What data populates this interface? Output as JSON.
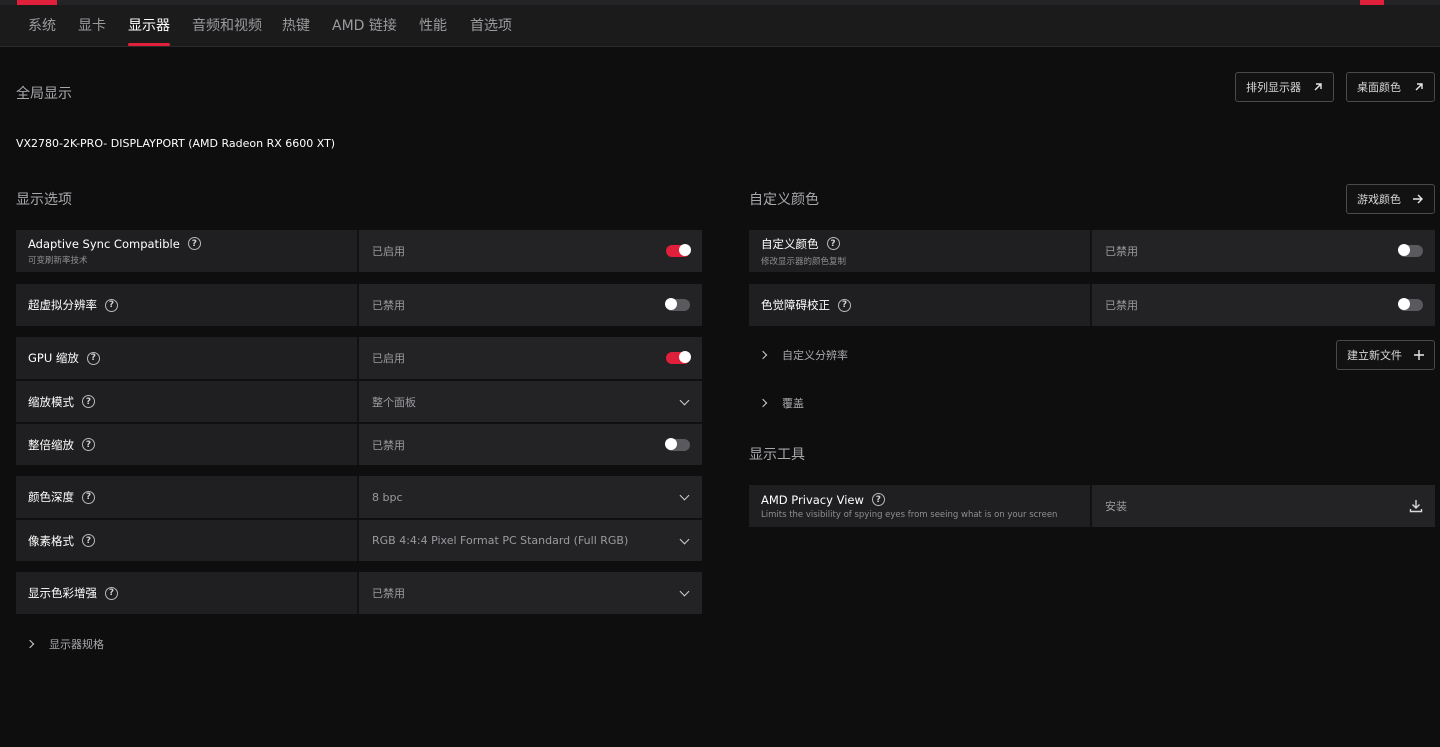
{
  "tabs": [
    {
      "label": "系统"
    },
    {
      "label": "显卡"
    },
    {
      "label": "显示器",
      "active": true
    },
    {
      "label": "音频和视频"
    },
    {
      "label": "热键"
    },
    {
      "label": "AMD 链接"
    },
    {
      "label": "性能"
    },
    {
      "label": "首选项"
    }
  ],
  "global": {
    "title": "全局显示",
    "arrange_label": "排列显示器",
    "desktop_color_label": "桌面颜色",
    "monitor_name": "VX2780-2K-PRO- DISPLAYPORT (AMD Radeon RX 6600 XT)"
  },
  "display_options": {
    "title": "显示选项",
    "rows": [
      {
        "label": "Adaptive Sync Compatible",
        "sub": "可变刷新率技术",
        "value": "已启用",
        "control": "toggle",
        "on": true
      },
      {
        "label": "超虚拟分辨率",
        "value": "已禁用",
        "control": "toggle",
        "on": false
      },
      {
        "label": "GPU 缩放",
        "value": "已启用",
        "control": "toggle",
        "on": true
      },
      {
        "label": "缩放模式",
        "value": "整个面板",
        "control": "dropdown"
      },
      {
        "label": "整倍缩放",
        "value": "已禁用",
        "control": "toggle",
        "on": false
      },
      {
        "label": "颜色深度",
        "value": "8 bpc",
        "control": "dropdown"
      },
      {
        "label": "像素格式",
        "value": "RGB 4:4:4 Pixel Format PC Standard (Full RGB)",
        "control": "dropdown"
      },
      {
        "label": "显示色彩增强",
        "value": "已禁用",
        "control": "dropdown"
      }
    ],
    "specs_label": "显示器规格"
  },
  "custom_color": {
    "title": "自定义颜色",
    "game_color_label": "游戏颜色",
    "rows": [
      {
        "label": "自定义颜色",
        "sub": "修改显示器的颜色复制",
        "value": "已禁用",
        "control": "toggle",
        "on": false
      },
      {
        "label": "色觉障碍校正",
        "value": "已禁用",
        "control": "toggle",
        "on": false
      }
    ],
    "custom_resolution_label": "自定义分辨率",
    "new_file_label": "建立新文件",
    "override_label": "覆盖"
  },
  "display_tools": {
    "title": "显示工具",
    "privacy": {
      "label": "AMD Privacy View",
      "sub": "Limits the visibility of spying eyes from seeing what is on your screen",
      "value": "安装"
    }
  },
  "colors": {
    "accent": "#e0203a",
    "background": "#0e0e0f",
    "row": "#1f1f21"
  },
  "icons": {
    "help": "help-circle-icon",
    "external": "arrow-up-right-icon",
    "arrow": "arrow-right-icon",
    "plus": "plus-icon",
    "download": "download-icon",
    "chevron_down": "chevron-down-icon",
    "chevron_right": "chevron-right-icon"
  }
}
